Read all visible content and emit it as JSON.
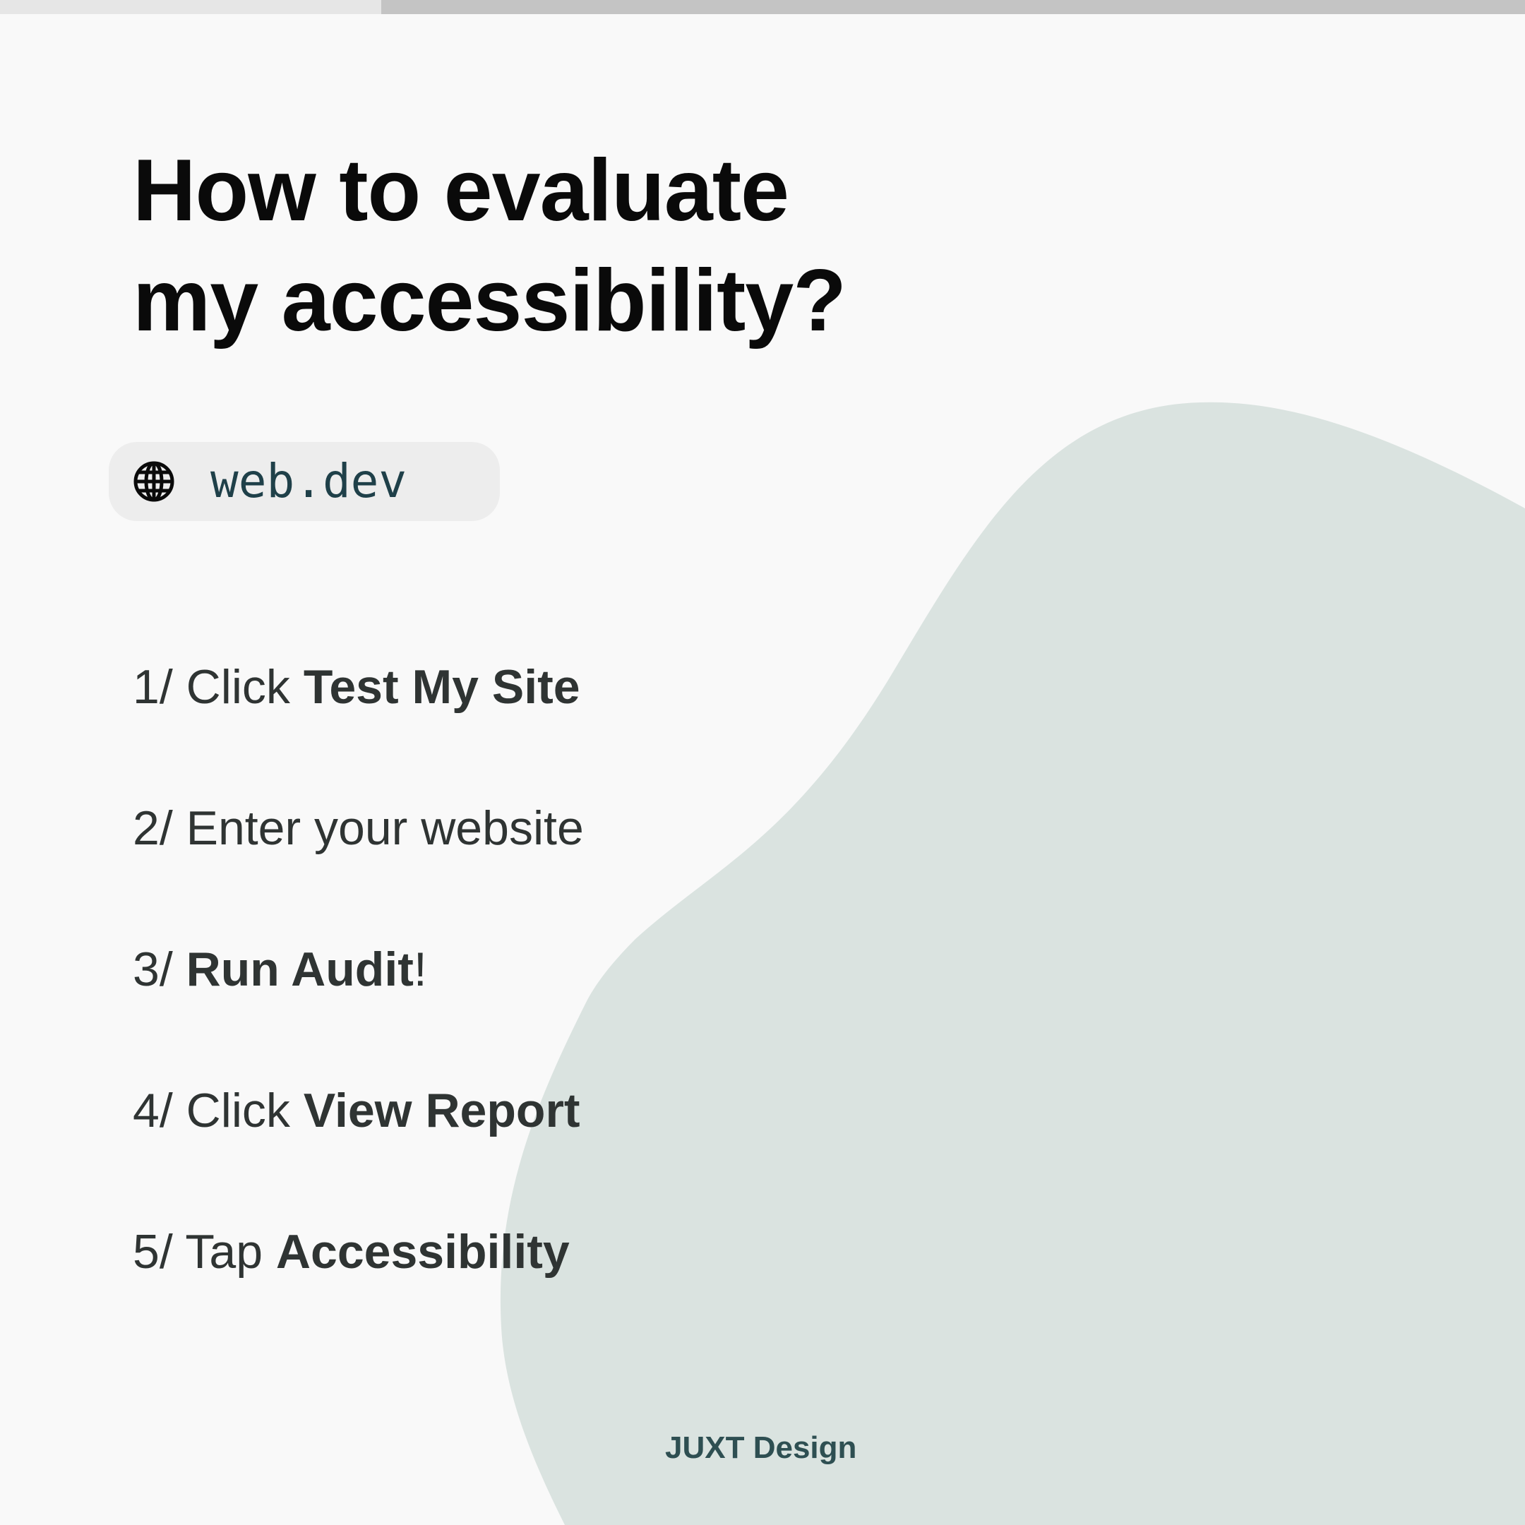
{
  "progress": {
    "fraction": 0.25
  },
  "colors": {
    "background": "#f9f9f9",
    "blob": "#dae3e0",
    "accent": "#1f4049",
    "text": "#2f3433"
  },
  "title": {
    "line1": "How to evaluate",
    "line2": "my accessibility?"
  },
  "link": {
    "icon": "globe-icon",
    "url": "web.dev"
  },
  "steps": [
    {
      "prefix": "1/ Click ",
      "bold": "Test My Site",
      "suffix": ""
    },
    {
      "prefix": "2/ Enter your website",
      "bold": "",
      "suffix": ""
    },
    {
      "prefix": "3/ ",
      "bold": "Run Audit",
      "suffix": "!"
    },
    {
      "prefix": "4/ Click ",
      "bold": "View Report",
      "suffix": ""
    },
    {
      "prefix": "5/ Tap ",
      "bold": "Accessibility",
      "suffix": ""
    }
  ],
  "brand": {
    "name": "JUXT Design"
  }
}
